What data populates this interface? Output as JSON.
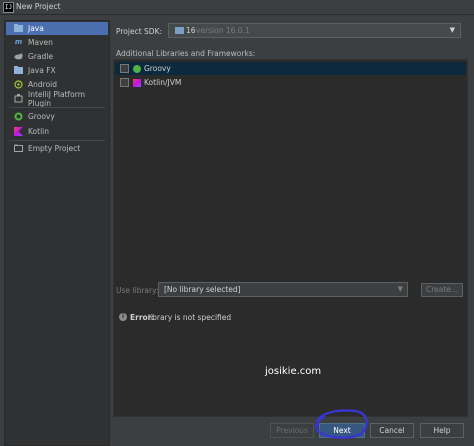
{
  "window": {
    "title": "New Project"
  },
  "sidebar": {
    "items": [
      {
        "label": "Java",
        "icon": "java-folder-icon",
        "selected": true
      },
      {
        "label": "Maven",
        "icon": "maven-icon"
      },
      {
        "label": "Gradle",
        "icon": "gradle-icon"
      },
      {
        "label": "Java FX",
        "icon": "javafx-folder-icon"
      },
      {
        "label": "Android",
        "icon": "android-icon"
      },
      {
        "label": "IntelliJ Platform Plugin",
        "icon": "plugin-icon"
      },
      {
        "label": "Groovy",
        "icon": "groovy-icon"
      },
      {
        "label": "Kotlin",
        "icon": "kotlin-icon"
      },
      {
        "label": "Empty Project",
        "icon": "empty-project-icon"
      }
    ]
  },
  "sdk": {
    "label": "Project SDK:",
    "value_number": "16",
    "value_version": "version 16.0.1"
  },
  "libraries": {
    "label": "Additional Libraries and Frameworks:",
    "items": [
      {
        "label": "Groovy",
        "checked": false,
        "selected": true
      },
      {
        "label": "Kotlin/JVM",
        "checked": false
      }
    ]
  },
  "use_library": {
    "label": "Use library:",
    "value": "[No library selected]",
    "create_label": "Create..."
  },
  "error": {
    "bold": "Error:",
    "text": "library is not specified"
  },
  "watermark": "josikie.com",
  "buttons": {
    "previous": "Previous",
    "next": "Next",
    "cancel": "Cancel",
    "help": "Help"
  },
  "colors": {
    "accent": "#4b6eaf",
    "primary_button": "#365880",
    "annotation_circle": "#3a34d6"
  }
}
